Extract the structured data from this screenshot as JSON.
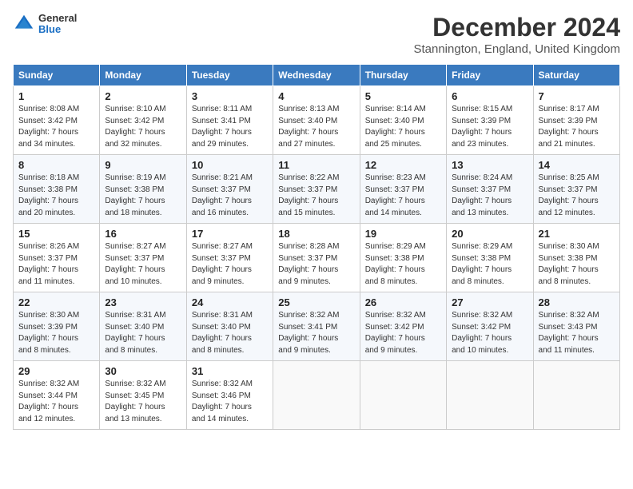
{
  "header": {
    "logo": {
      "general": "General",
      "blue": "Blue"
    },
    "title": "December 2024",
    "location": "Stannington, England, United Kingdom"
  },
  "calendar": {
    "days_of_week": [
      "Sunday",
      "Monday",
      "Tuesday",
      "Wednesday",
      "Thursday",
      "Friday",
      "Saturday"
    ],
    "weeks": [
      [
        null,
        null,
        null,
        null,
        null,
        null,
        null
      ]
    ]
  },
  "days": {
    "headers": [
      "Sunday",
      "Monday",
      "Tuesday",
      "Wednesday",
      "Thursday",
      "Friday",
      "Saturday"
    ],
    "rows": [
      [
        {
          "num": "1",
          "info": "Sunrise: 8:08 AM\nSunset: 3:42 PM\nDaylight: 7 hours\nand 34 minutes."
        },
        {
          "num": "2",
          "info": "Sunrise: 8:10 AM\nSunset: 3:42 PM\nDaylight: 7 hours\nand 32 minutes."
        },
        {
          "num": "3",
          "info": "Sunrise: 8:11 AM\nSunset: 3:41 PM\nDaylight: 7 hours\nand 29 minutes."
        },
        {
          "num": "4",
          "info": "Sunrise: 8:13 AM\nSunset: 3:40 PM\nDaylight: 7 hours\nand 27 minutes."
        },
        {
          "num": "5",
          "info": "Sunrise: 8:14 AM\nSunset: 3:40 PM\nDaylight: 7 hours\nand 25 minutes."
        },
        {
          "num": "6",
          "info": "Sunrise: 8:15 AM\nSunset: 3:39 PM\nDaylight: 7 hours\nand 23 minutes."
        },
        {
          "num": "7",
          "info": "Sunrise: 8:17 AM\nSunset: 3:39 PM\nDaylight: 7 hours\nand 21 minutes."
        }
      ],
      [
        {
          "num": "8",
          "info": "Sunrise: 8:18 AM\nSunset: 3:38 PM\nDaylight: 7 hours\nand 20 minutes."
        },
        {
          "num": "9",
          "info": "Sunrise: 8:19 AM\nSunset: 3:38 PM\nDaylight: 7 hours\nand 18 minutes."
        },
        {
          "num": "10",
          "info": "Sunrise: 8:21 AM\nSunset: 3:37 PM\nDaylight: 7 hours\nand 16 minutes."
        },
        {
          "num": "11",
          "info": "Sunrise: 8:22 AM\nSunset: 3:37 PM\nDaylight: 7 hours\nand 15 minutes."
        },
        {
          "num": "12",
          "info": "Sunrise: 8:23 AM\nSunset: 3:37 PM\nDaylight: 7 hours\nand 14 minutes."
        },
        {
          "num": "13",
          "info": "Sunrise: 8:24 AM\nSunset: 3:37 PM\nDaylight: 7 hours\nand 13 minutes."
        },
        {
          "num": "14",
          "info": "Sunrise: 8:25 AM\nSunset: 3:37 PM\nDaylight: 7 hours\nand 12 minutes."
        }
      ],
      [
        {
          "num": "15",
          "info": "Sunrise: 8:26 AM\nSunset: 3:37 PM\nDaylight: 7 hours\nand 11 minutes."
        },
        {
          "num": "16",
          "info": "Sunrise: 8:27 AM\nSunset: 3:37 PM\nDaylight: 7 hours\nand 10 minutes."
        },
        {
          "num": "17",
          "info": "Sunrise: 8:27 AM\nSunset: 3:37 PM\nDaylight: 7 hours\nand 9 minutes."
        },
        {
          "num": "18",
          "info": "Sunrise: 8:28 AM\nSunset: 3:37 PM\nDaylight: 7 hours\nand 9 minutes."
        },
        {
          "num": "19",
          "info": "Sunrise: 8:29 AM\nSunset: 3:38 PM\nDaylight: 7 hours\nand 8 minutes."
        },
        {
          "num": "20",
          "info": "Sunrise: 8:29 AM\nSunset: 3:38 PM\nDaylight: 7 hours\nand 8 minutes."
        },
        {
          "num": "21",
          "info": "Sunrise: 8:30 AM\nSunset: 3:38 PM\nDaylight: 7 hours\nand 8 minutes."
        }
      ],
      [
        {
          "num": "22",
          "info": "Sunrise: 8:30 AM\nSunset: 3:39 PM\nDaylight: 7 hours\nand 8 minutes."
        },
        {
          "num": "23",
          "info": "Sunrise: 8:31 AM\nSunset: 3:40 PM\nDaylight: 7 hours\nand 8 minutes."
        },
        {
          "num": "24",
          "info": "Sunrise: 8:31 AM\nSunset: 3:40 PM\nDaylight: 7 hours\nand 8 minutes."
        },
        {
          "num": "25",
          "info": "Sunrise: 8:32 AM\nSunset: 3:41 PM\nDaylight: 7 hours\nand 9 minutes."
        },
        {
          "num": "26",
          "info": "Sunrise: 8:32 AM\nSunset: 3:42 PM\nDaylight: 7 hours\nand 9 minutes."
        },
        {
          "num": "27",
          "info": "Sunrise: 8:32 AM\nSunset: 3:42 PM\nDaylight: 7 hours\nand 10 minutes."
        },
        {
          "num": "28",
          "info": "Sunrise: 8:32 AM\nSunset: 3:43 PM\nDaylight: 7 hours\nand 11 minutes."
        }
      ],
      [
        {
          "num": "29",
          "info": "Sunrise: 8:32 AM\nSunset: 3:44 PM\nDaylight: 7 hours\nand 12 minutes."
        },
        {
          "num": "30",
          "info": "Sunrise: 8:32 AM\nSunset: 3:45 PM\nDaylight: 7 hours\nand 13 minutes."
        },
        {
          "num": "31",
          "info": "Sunrise: 8:32 AM\nSunset: 3:46 PM\nDaylight: 7 hours\nand 14 minutes."
        },
        null,
        null,
        null,
        null
      ]
    ]
  }
}
